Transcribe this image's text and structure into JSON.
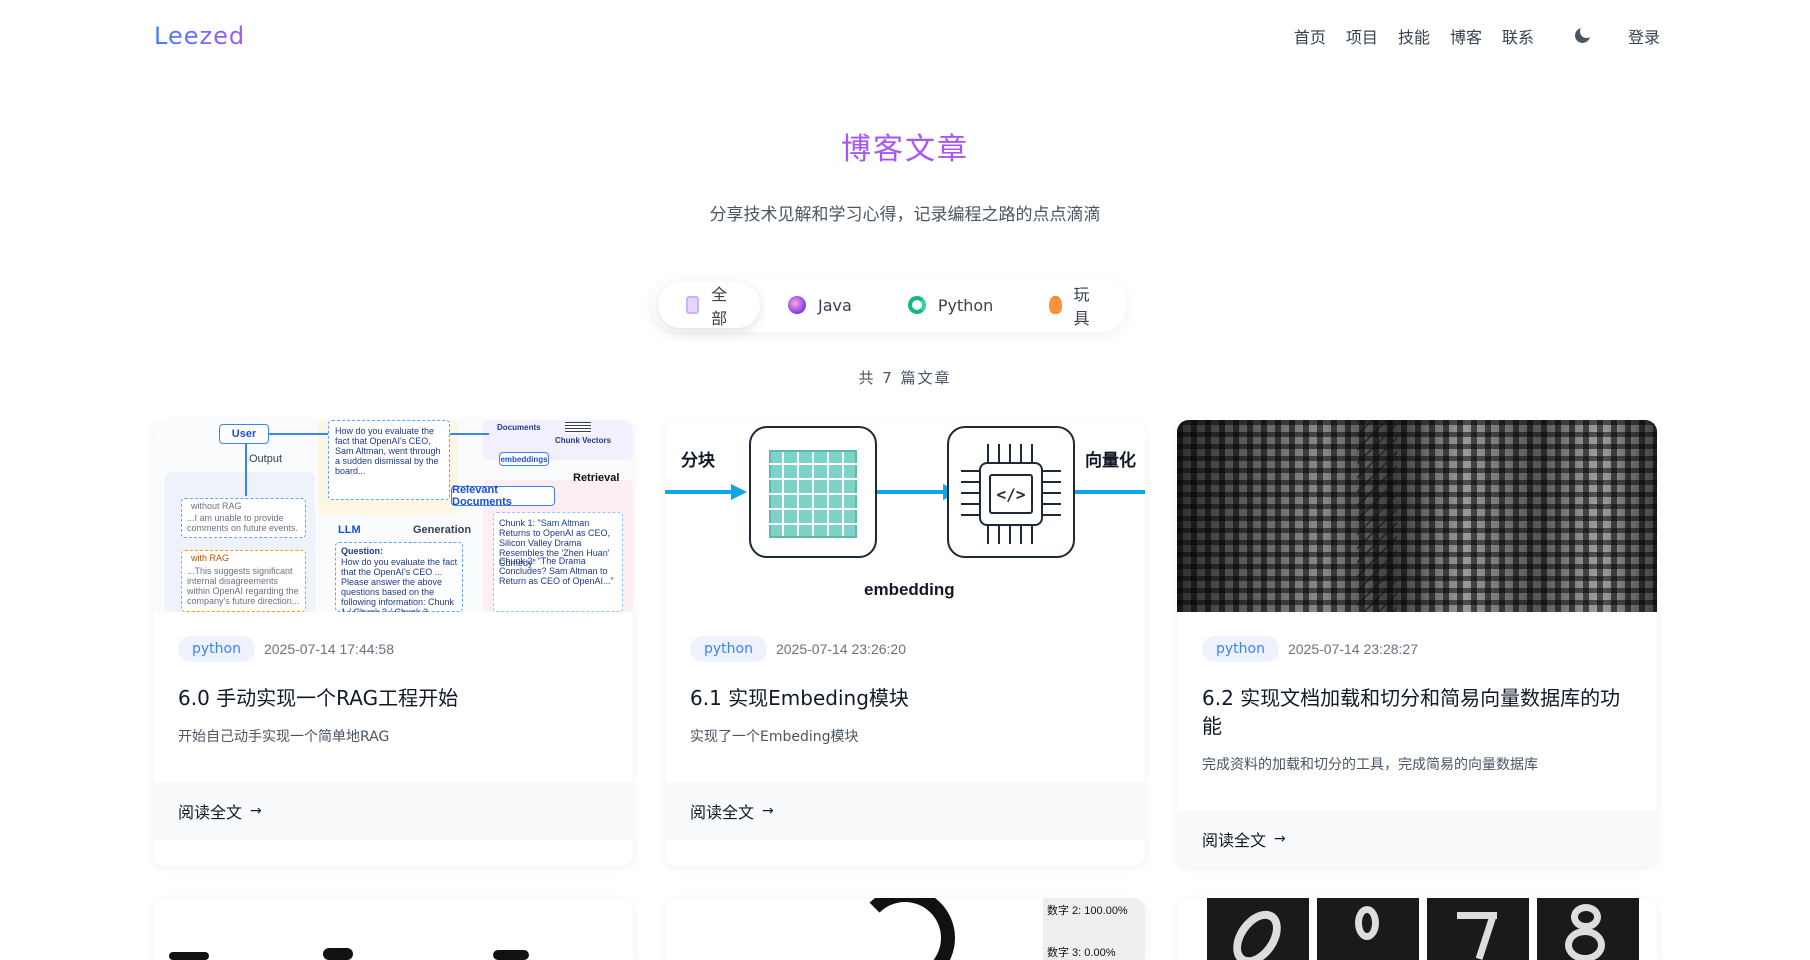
{
  "header": {
    "logo": "Leezed",
    "nav": [
      "首页",
      "项目",
      "技能",
      "博客",
      "联系"
    ],
    "theme_icon": "moon-icon",
    "login": "登录"
  },
  "hero": {
    "title": "博客文章",
    "subtitle": "分享技术见解和学习心得，记录编程之路的点点滴滴"
  },
  "tabs": [
    {
      "label": "全部",
      "icon": "document-icon",
      "active": true
    },
    {
      "label": "Java",
      "icon": "java-icon",
      "active": false
    },
    {
      "label": "Python",
      "icon": "python-icon",
      "active": false
    },
    {
      "label": "玩具",
      "icon": "toy-icon",
      "active": false
    }
  ],
  "count_text": "共 7 篇文章",
  "cards": [
    {
      "tag": "python",
      "date": "2025-07-14 17:44:58",
      "title": "6.0 手动实现一个RAG工程开始",
      "desc": "开始自己动手实现一个简单地RAG",
      "read_more": "阅读全文",
      "thumb_text": {
        "user": "User",
        "output": "Output",
        "llm": "LLM",
        "generation": "Generation",
        "retrieval": "Retrieval",
        "relevant": "Relevant Documents",
        "embeddings": "embeddings",
        "documents": "Documents",
        "chunk_vectors": "Chunk Vectors",
        "without_rag": "without RAG",
        "with_rag": "with RAG",
        "question": "Question:"
      }
    },
    {
      "tag": "python",
      "date": "2025-07-14 23:26:20",
      "title": "6.1 实现Embeding模块",
      "desc": "实现了一个Embeding模块",
      "read_more": "阅读全文",
      "thumb_text": {
        "left": "分块",
        "right": "向量化",
        "bottom": "embedding",
        "code": "</>"
      }
    },
    {
      "tag": "python",
      "date": "2025-07-14 23:28:27",
      "title": "6.2 实现文档加载和切分和简易向量数据库的功能",
      "desc": "完成资料的加载和切分的工具，完成简易的向量数据库",
      "read_more": "阅读全文"
    }
  ],
  "peek": {
    "pct1": "数字 2: 100.00%",
    "pct2": "数字 3: 0.00%"
  },
  "colors": {
    "accent": "#a855f7",
    "tag_bg": "#eef2ff",
    "tag_text": "#3b82f6",
    "flow_arrow": "#0ea5e9"
  }
}
